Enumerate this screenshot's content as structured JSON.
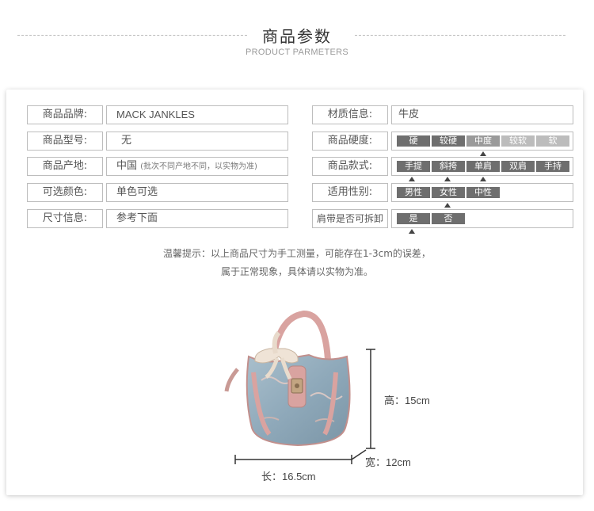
{
  "header": {
    "title": "商品参数",
    "subtitle": "PRODUCT PARMETERS"
  },
  "left_rows": [
    {
      "label": "商品品牌:",
      "value": "MACK JANKLES",
      "note": ""
    },
    {
      "label": "商品型号:",
      "value": "无",
      "note": ""
    },
    {
      "label": "商品产地:",
      "value": "中国",
      "note": "(批次不同产地不同，以实物为准)"
    },
    {
      "label": "可选颜色:",
      "value": "单色可选",
      "note": ""
    },
    {
      "label": "尺寸信息:",
      "value": "参考下面",
      "note": ""
    }
  ],
  "material": {
    "label": "材质信息:",
    "value": "牛皮"
  },
  "hardness": {
    "label": "商品硬度:",
    "options": [
      "硬",
      "较硬",
      "中度",
      "较软",
      "软"
    ],
    "selected": "中度"
  },
  "style": {
    "label": "商品款式:",
    "options": [
      "手提",
      "斜挎",
      "单肩",
      "双肩",
      "手持"
    ],
    "selected": [
      "手提",
      "斜挎",
      "单肩"
    ]
  },
  "gender": {
    "label": "适用性别:",
    "options": [
      "男性",
      "女性",
      "中性"
    ],
    "selected": "女性"
  },
  "strap": {
    "label": "肩带是否可拆卸",
    "options": [
      "是",
      "否"
    ],
    "selected": "是"
  },
  "tip": {
    "line1": "温馨提示：以上商品尺寸为手工测量，可能存在1-3cm的误差，",
    "line2": "属于正常现象，具体请以实物为准。"
  },
  "dimensions": {
    "height": "高：15cm",
    "length": "长：16.5cm",
    "width": "宽：12cm"
  },
  "colors": {
    "chip_dark": "#6e6e6e",
    "chip_mid": "#9a9a9a",
    "chip_light": "#bcbcbc",
    "border": "#bdbdbd"
  }
}
